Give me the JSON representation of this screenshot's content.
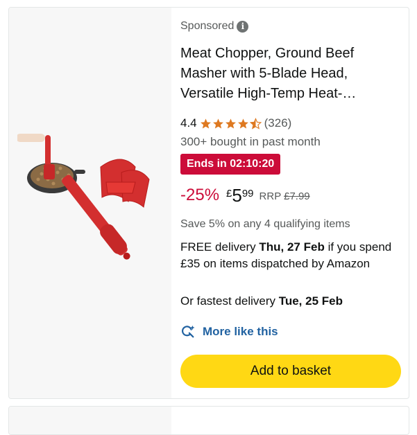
{
  "product": {
    "sponsored_label": "Sponsored",
    "info_icon": "info-icon",
    "title": "Meat Chopper, Ground Beef Masher with 5-Blade Head, Versatile High-Temp Heat-…",
    "rating": "4.4",
    "rating_stars": 4.4,
    "rating_count": "(326)",
    "bought": "300+ bought in past month",
    "deal": "Ends in 02:10:20",
    "discount": "-25%",
    "price_symbol": "£",
    "price_whole": "5",
    "price_fraction": "99",
    "rrp_label": "RRP",
    "rrp_value": "£7.99",
    "save_text": "Save 5% on any 4 qualifying items",
    "delivery_prefix": "FREE delivery ",
    "delivery_date": "Thu, 27 Feb",
    "delivery_suffix": " if you spend £35 on items dispatched by Amazon",
    "fastest_prefix": "Or fastest delivery ",
    "fastest_date": "Tue, 25 Feb",
    "more_like_label": "More like this",
    "more_like_icon": "sparkle-search-icon",
    "add_to_basket": "Add to basket"
  },
  "colors": {
    "deal_red": "#cc0c39",
    "button_yellow": "#ffd814",
    "link_blue": "#2162a1",
    "star_orange": "#de7921"
  }
}
